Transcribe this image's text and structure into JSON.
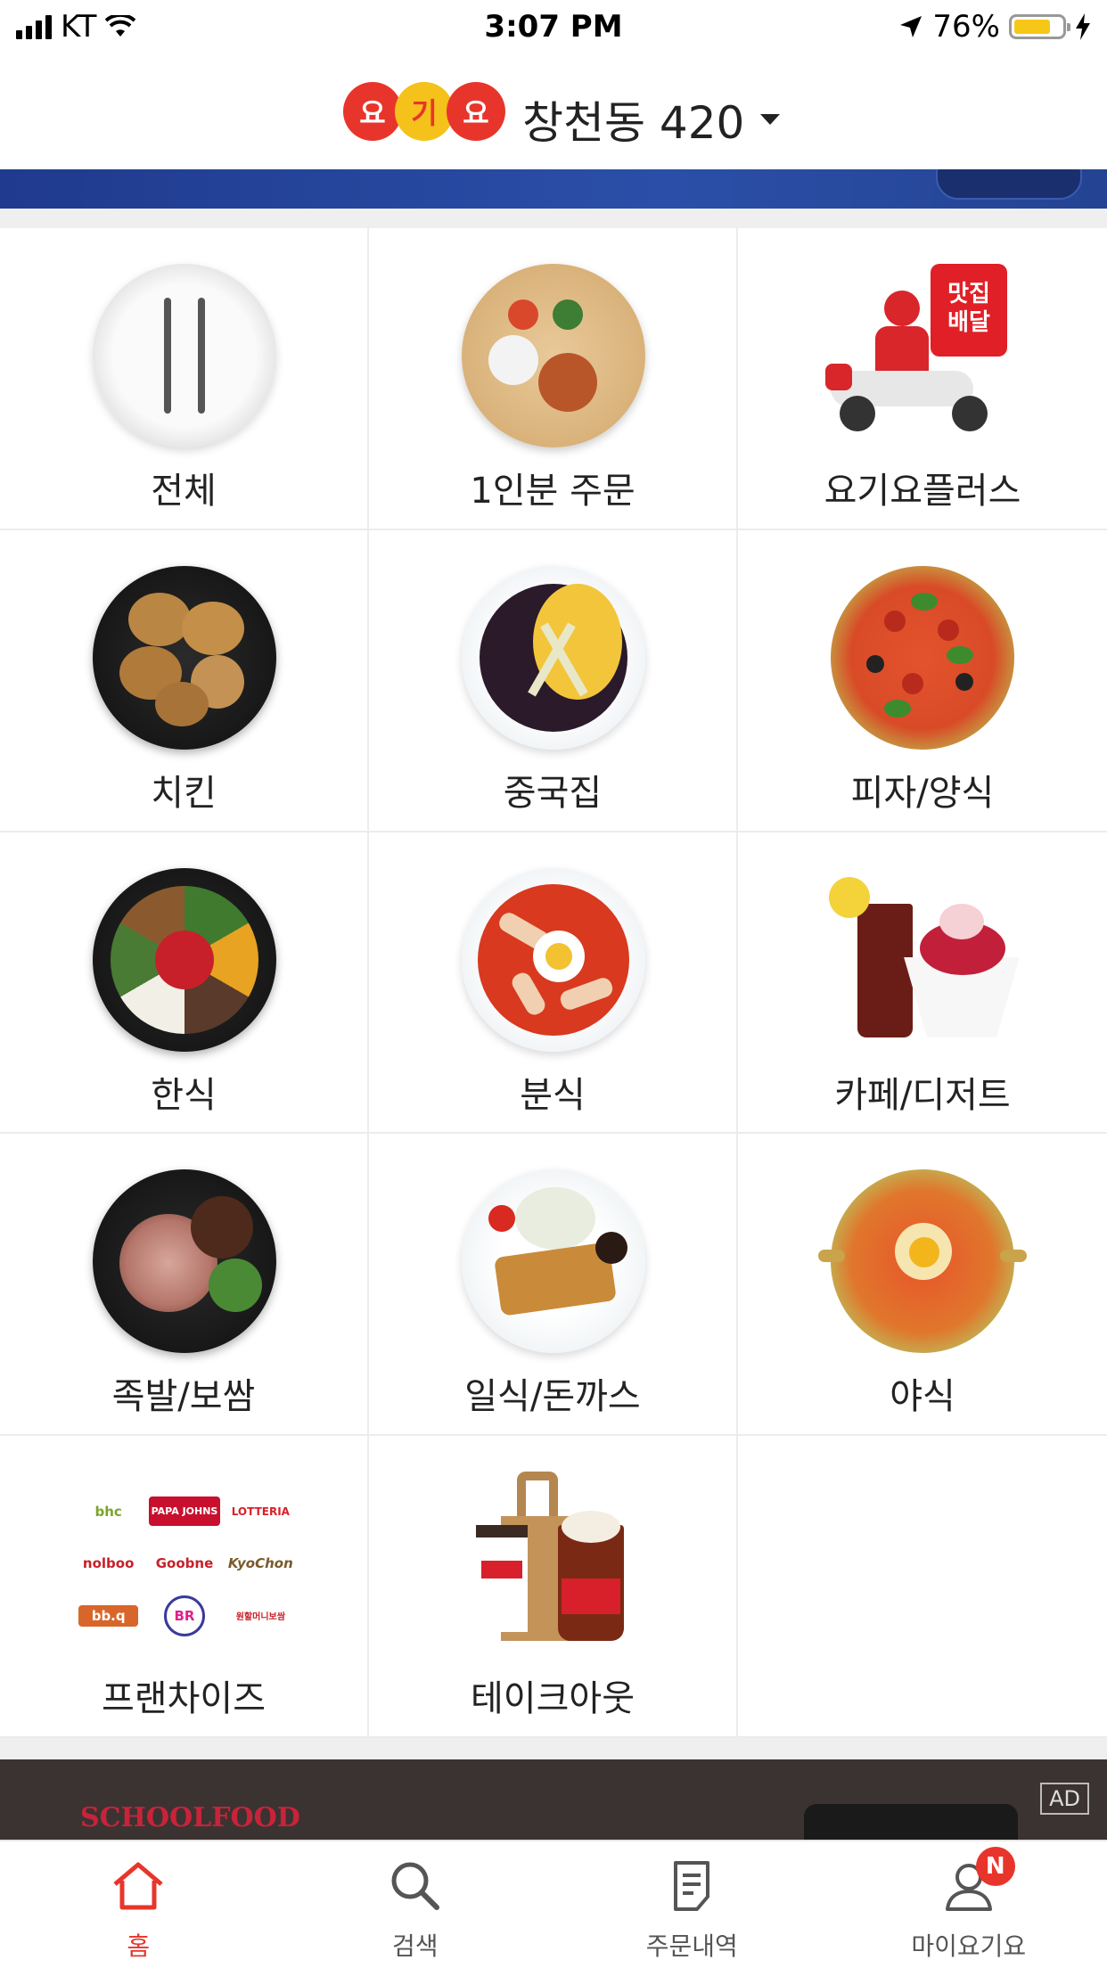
{
  "status_bar": {
    "carrier": "KT",
    "time": "3:07 PM",
    "battery_percent": "76%",
    "battery_level": 0.76
  },
  "header": {
    "logo": [
      "요",
      "기",
      "요"
    ],
    "location": "창천동 420"
  },
  "categories": [
    {
      "label": "전체",
      "icon": "cutlery-plate"
    },
    {
      "label": "1인분 주문",
      "icon": "single-meal-tray"
    },
    {
      "label": "요기요플러스",
      "icon": "delivery-scooter"
    },
    {
      "label": "치킨",
      "icon": "fried-chicken"
    },
    {
      "label": "중국집",
      "icon": "jajangmyeon"
    },
    {
      "label": "피자/양식",
      "icon": "pizza"
    },
    {
      "label": "한식",
      "icon": "bibimbap"
    },
    {
      "label": "분식",
      "icon": "tteokbokki"
    },
    {
      "label": "카페/디저트",
      "icon": "iced-drink-bingsu"
    },
    {
      "label": "족발/보쌈",
      "icon": "jokbal"
    },
    {
      "label": "일식/돈까스",
      "icon": "tonkatsu"
    },
    {
      "label": "야식",
      "icon": "ramen-pot"
    },
    {
      "label": "프랜차이즈",
      "icon": "franchise-logos"
    },
    {
      "label": "테이크아웃",
      "icon": "takeout-cups"
    }
  ],
  "scooter_box_text": "맛집\n배달",
  "franchise_logos": [
    "bhc",
    "PAPA JOHNS",
    "LOTTERIA",
    "nolboo",
    "Goobne",
    "KyoChon",
    "bb.q",
    "BR",
    "원할머니보쌈"
  ],
  "ad": {
    "brand": "SCHOOLFOOD",
    "badge": "AD"
  },
  "tabbar": {
    "tabs": [
      {
        "label": "홈",
        "icon": "home-icon",
        "active": true
      },
      {
        "label": "검색",
        "icon": "search-icon",
        "active": false
      },
      {
        "label": "주문내역",
        "icon": "order-history-icon",
        "active": false
      },
      {
        "label": "마이요기요",
        "icon": "profile-icon",
        "active": false,
        "badge": "N"
      }
    ]
  },
  "colors": {
    "brand_red": "#e8352b",
    "brand_yellow": "#f4c21a",
    "battery_fill": "#f7c718"
  }
}
